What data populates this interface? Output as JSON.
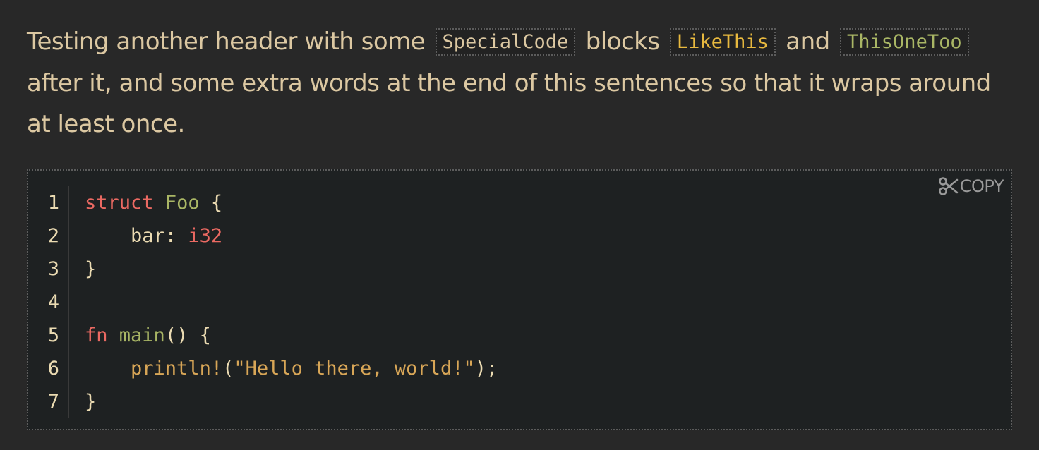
{
  "paragraph": {
    "text_1": "Testing another header with some",
    "code_1": "SpecialCode",
    "text_2": "blocks",
    "code_2": "LikeThis",
    "text_3": "and",
    "code_3": "ThisOneToo",
    "text_4": "after it, and some extra words at the end of this sentences so that it wraps around at least once."
  },
  "colors": {
    "background": "#282828",
    "code_background": "#1e2122",
    "text": "#dcc8a2",
    "code_1": "#dcc8a2",
    "code_2": "#e8b93f",
    "code_3": "#a9b665",
    "keyword": "#ea6962",
    "type": "#a9b665",
    "macro": "#d8a657"
  },
  "code_block": {
    "copy_label": "COPY",
    "copy_icon": "scissors-icon",
    "line_numbers": [
      "1",
      "2",
      "3",
      "4",
      "5",
      "6",
      "7"
    ],
    "lines": [
      [
        {
          "t": "struct",
          "c": "kw"
        },
        {
          "t": " ",
          "c": "id"
        },
        {
          "t": "Foo",
          "c": "ty"
        },
        {
          "t": " {",
          "c": "id"
        }
      ],
      [
        {
          "t": "    bar: ",
          "c": "id"
        },
        {
          "t": "i32",
          "c": "kw"
        }
      ],
      [
        {
          "t": "}",
          "c": "id"
        }
      ],
      [],
      [
        {
          "t": "fn",
          "c": "kw"
        },
        {
          "t": " ",
          "c": "id"
        },
        {
          "t": "main",
          "c": "fn"
        },
        {
          "t": "() {",
          "c": "id"
        }
      ],
      [
        {
          "t": "    ",
          "c": "id"
        },
        {
          "t": "println!",
          "c": "mac"
        },
        {
          "t": "(",
          "c": "id"
        },
        {
          "t": "\"Hello there, world!\"",
          "c": "str"
        },
        {
          "t": ");",
          "c": "id"
        }
      ],
      [
        {
          "t": "}",
          "c": "id"
        }
      ]
    ]
  }
}
